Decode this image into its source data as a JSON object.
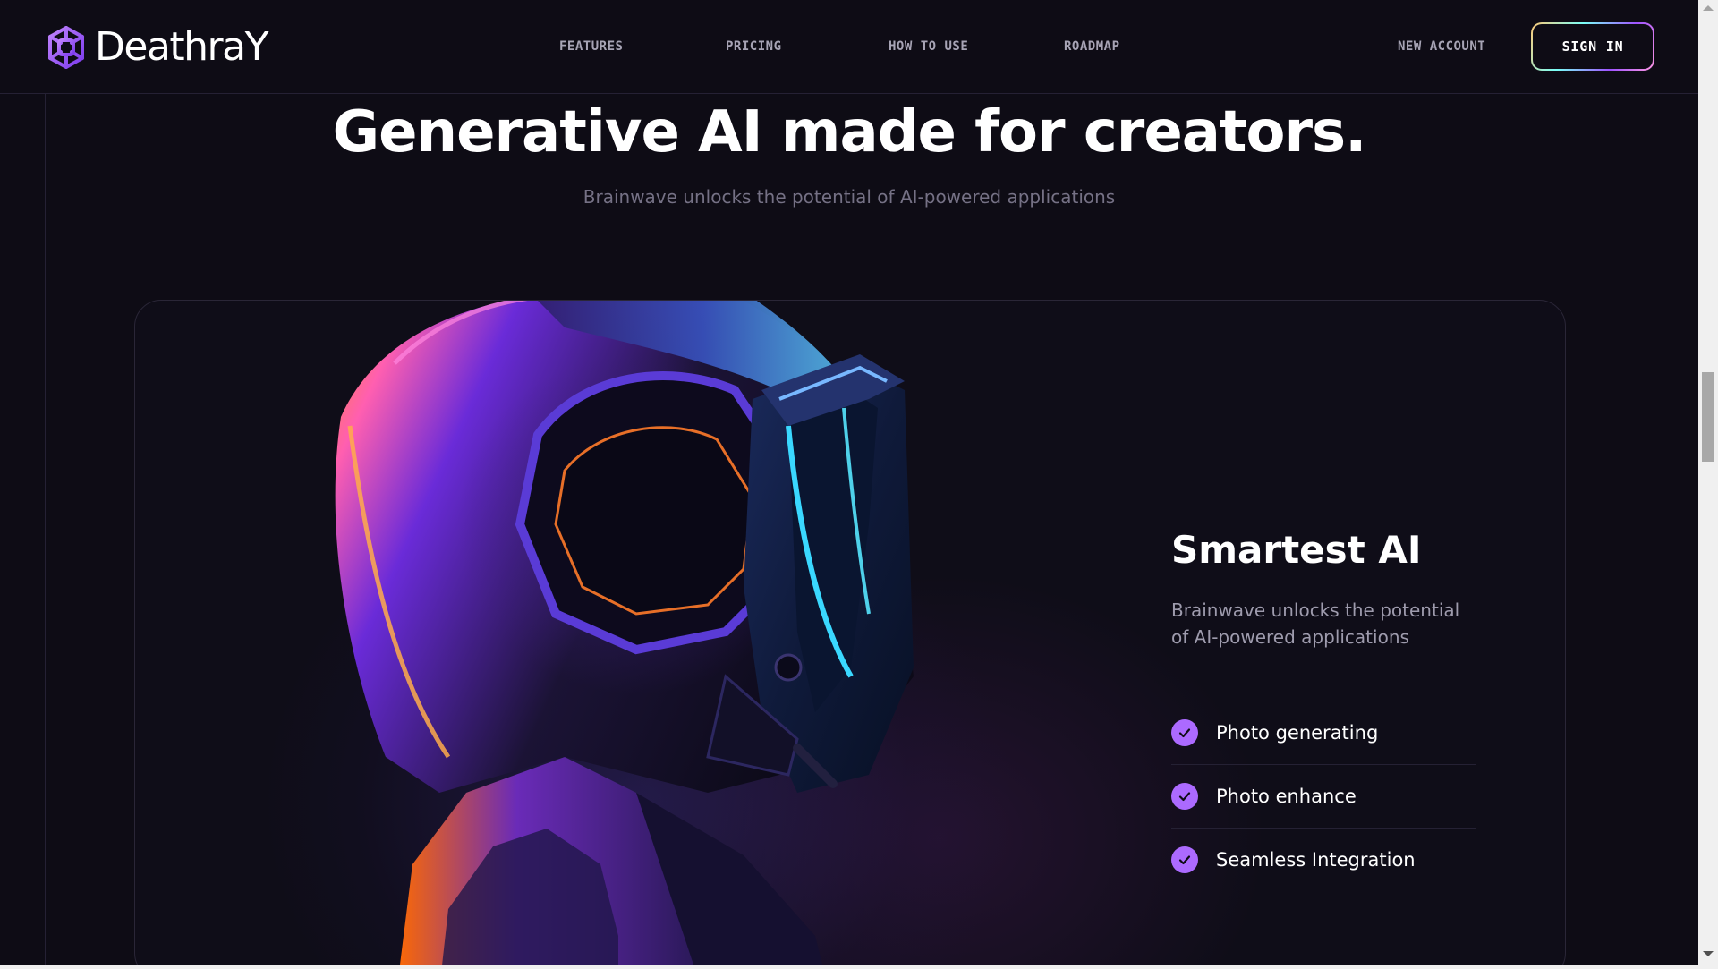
{
  "brand": {
    "name": "DeathraY",
    "logo_icon": "brain-logo-icon"
  },
  "nav": {
    "items": [
      {
        "label": "FEATURES"
      },
      {
        "label": "PRICING"
      },
      {
        "label": "HOW TO USE"
      },
      {
        "label": "ROADMAP"
      }
    ],
    "new_account": "NEW ACCOUNT",
    "sign_in": "SIGN IN"
  },
  "hero": {
    "title": "Generative AI made for creators.",
    "subtitle": "Brainwave unlocks the potential of AI-powered applications"
  },
  "feature_card": {
    "image_alt": "Futuristic helmeted robot profile",
    "title": "Smartest AI",
    "description": "Brainwave unlocks the potential of AI-powered applications",
    "items": [
      {
        "label": "Photo generating",
        "icon": "check-icon"
      },
      {
        "label": "Photo enhance",
        "icon": "check-icon"
      },
      {
        "label": "Seamless Integration",
        "icon": "check-icon"
      }
    ]
  },
  "colors": {
    "background": "#0e0c15",
    "accent_purple": "#ac6aff",
    "muted_text": "#757185",
    "border": "#252134"
  }
}
